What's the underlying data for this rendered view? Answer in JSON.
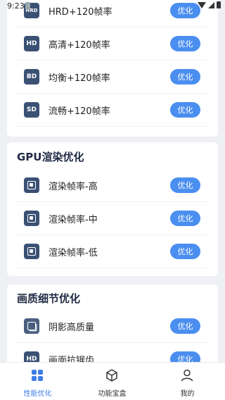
{
  "status_bar": {
    "time": "9:23"
  },
  "resolution_section": {
    "rows": [
      {
        "icon_text": "HRD",
        "label": "HRD+120帧率",
        "button": "优化"
      },
      {
        "icon_text": "HD",
        "label": "高清+120帧率",
        "button": "优化"
      },
      {
        "icon_text": "BD",
        "label": "均衡+120帧率",
        "button": "优化"
      },
      {
        "icon_text": "SD",
        "label": "流畅+120帧率",
        "button": "优化"
      }
    ]
  },
  "gpu_section": {
    "title": "GPU渲染优化",
    "rows": [
      {
        "icon": "chip-icon",
        "label": "渲染帧率-高",
        "button": "优化"
      },
      {
        "icon": "chip-icon",
        "label": "渲染帧率-中",
        "button": "优化"
      },
      {
        "icon": "chip-icon",
        "label": "渲染帧率-低",
        "button": "优化"
      }
    ]
  },
  "quality_section": {
    "title": "画质细节优化",
    "rows": [
      {
        "icon": "layers-icon",
        "label": "阴影高质量",
        "button": "优化"
      },
      {
        "icon_text": "HD",
        "label": "画面抗锯齿",
        "button": "优化"
      }
    ]
  },
  "tabbar": {
    "tabs": [
      {
        "label": "性能优化",
        "icon": "grid-icon",
        "active": true
      },
      {
        "label": "功能宝盒",
        "icon": "box-icon",
        "active": false
      },
      {
        "label": "我的",
        "icon": "person-icon",
        "active": false
      }
    ]
  },
  "colors": {
    "accent": "#4a8ef0",
    "icon_bg": "#3a5174",
    "title": "#1e2a44",
    "background": "#eef0f4"
  }
}
